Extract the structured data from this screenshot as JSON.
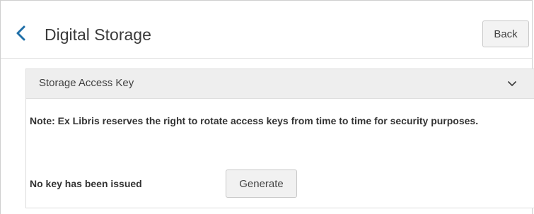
{
  "header": {
    "back_icon": "chevron-left-icon",
    "title": "Digital Storage",
    "back_button_label": "Back"
  },
  "panel": {
    "title": "Storage Access Key",
    "toggle_icon": "chevron-down-icon",
    "expanded": true,
    "note": "Note: Ex Libris reserves the right to rotate access keys from time to time for security purposes.",
    "key_status": "No key has been issued",
    "generate_button_label": "Generate"
  },
  "colors": {
    "accent": "#1f6fa8",
    "panel_header_bg": "#eeeeee",
    "button_bg": "#f3f3f3",
    "border": "#c8c8c8"
  }
}
